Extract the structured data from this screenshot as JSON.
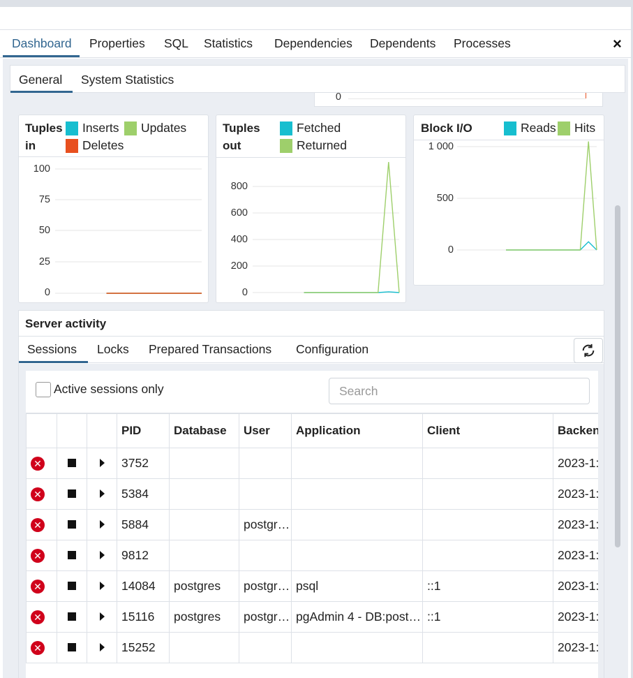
{
  "main_tabs": [
    "Dashboard",
    "Properties",
    "SQL",
    "Statistics",
    "Dependencies",
    "Dependents",
    "Processes"
  ],
  "close_label": "×",
  "sub_tabs": [
    "General",
    "System Statistics"
  ],
  "prev_chart_tick": "0",
  "tuples_in": {
    "title_line1": "Tuples",
    "title_line2": "in",
    "legend": [
      {
        "label": "Inserts",
        "color": "#17becf"
      },
      {
        "label": "Updates",
        "color": "#9ecf6b"
      },
      {
        "label": "Deletes",
        "color": "#e8501f"
      }
    ],
    "ticks": [
      "100",
      "75",
      "50",
      "25",
      "0"
    ]
  },
  "tuples_out": {
    "title_line1": "Tuples",
    "title_line2": "out",
    "legend": [
      {
        "label": "Fetched",
        "color": "#17becf"
      },
      {
        "label": "Returned",
        "color": "#9ecf6b"
      }
    ],
    "ticks": [
      "800",
      "600",
      "400",
      "200",
      "0"
    ]
  },
  "block_io": {
    "title": "Block I/O",
    "legend": [
      {
        "label": "Reads",
        "color": "#17becf"
      },
      {
        "label": "Hits",
        "color": "#9ecf6b"
      }
    ],
    "ticks": [
      "1 000",
      "500",
      "0"
    ]
  },
  "chart_data": [
    {
      "type": "line",
      "title": "Tuples in",
      "ylim": [
        0,
        100
      ],
      "series": [
        {
          "name": "Inserts",
          "values": [
            0,
            0,
            0,
            0,
            0,
            0,
            0,
            0,
            0,
            0
          ]
        },
        {
          "name": "Updates",
          "values": [
            0,
            0,
            0,
            0,
            0,
            0,
            0,
            0,
            0,
            0
          ]
        },
        {
          "name": "Deletes",
          "values": [
            0,
            0,
            0,
            0,
            0,
            0,
            0,
            0,
            0,
            0
          ]
        }
      ]
    },
    {
      "type": "line",
      "title": "Tuples out",
      "ylim": [
        0,
        800
      ],
      "series": [
        {
          "name": "Fetched",
          "values": [
            0,
            0,
            0,
            0,
            0,
            0,
            0,
            0,
            5,
            0
          ]
        },
        {
          "name": "Returned",
          "values": [
            0,
            0,
            0,
            0,
            0,
            0,
            0,
            0,
            850,
            0
          ]
        }
      ]
    },
    {
      "type": "line",
      "title": "Block I/O",
      "ylim": [
        0,
        1000
      ],
      "series": [
        {
          "name": "Reads",
          "values": [
            0,
            0,
            0,
            0,
            0,
            0,
            0,
            0,
            0,
            0,
            80,
            0
          ]
        },
        {
          "name": "Hits",
          "values": [
            0,
            0,
            0,
            0,
            0,
            0,
            0,
            0,
            0,
            0,
            1050,
            0
          ]
        }
      ]
    }
  ],
  "server_activity": {
    "title": "Server activity",
    "tabs": [
      "Sessions",
      "Locks",
      "Prepared Transactions",
      "Configuration"
    ],
    "active_only_label": "Active sessions only",
    "search_placeholder": "Search",
    "columns": [
      "",
      "",
      "",
      "PID",
      "Database",
      "User",
      "Application",
      "Client",
      "Backen"
    ],
    "rows": [
      {
        "pid": "3752",
        "database": "",
        "user": "",
        "application": "",
        "client": "",
        "backend": "2023-1:"
      },
      {
        "pid": "5384",
        "database": "",
        "user": "",
        "application": "",
        "client": "",
        "backend": "2023-1:"
      },
      {
        "pid": "5884",
        "database": "",
        "user": "postgr…",
        "application": "",
        "client": "",
        "backend": "2023-1:"
      },
      {
        "pid": "9812",
        "database": "",
        "user": "",
        "application": "",
        "client": "",
        "backend": "2023-1:"
      },
      {
        "pid": "14084",
        "database": "postgres",
        "user": "postgr…",
        "application": "psql",
        "client": "::1",
        "backend": "2023-1:"
      },
      {
        "pid": "15116",
        "database": "postgres",
        "user": "postgr…",
        "application": "pgAdmin 4 - DB:post…",
        "client": "::1",
        "backend": "2023-1:"
      },
      {
        "pid": "15252",
        "database": "",
        "user": "",
        "application": "",
        "client": "",
        "backend": "2023-1:"
      }
    ]
  }
}
